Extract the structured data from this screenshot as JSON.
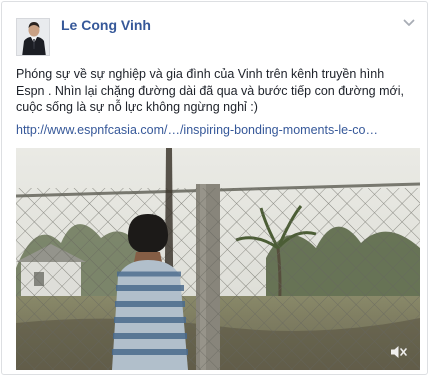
{
  "post": {
    "author": {
      "name": "Le Cong Vinh"
    },
    "text_lines": [
      "Phóng sự về sự nghiệp và gia đình của Vinh trên kênh truyền hình",
      "Espn . Nhìn lại chặng đường dài đã qua và bước tiếp con đường mới,",
      "cuộc sống là sự nỗ lực không ngừng nghỉ :)"
    ],
    "link": "http://www.espnfcasia.com/…/inspiring-bonding-moments-le-co…",
    "icons": {
      "menu": "chevron-down-icon",
      "volume": "mute-icon"
    }
  }
}
